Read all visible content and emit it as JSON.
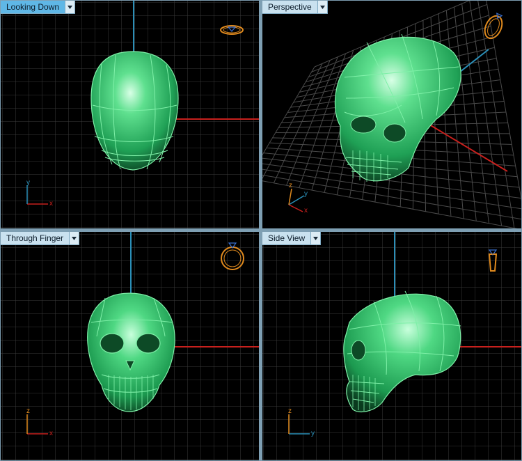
{
  "viewports": [
    {
      "label": "Looking Down",
      "active": true,
      "axes": [
        "y",
        "x"
      ]
    },
    {
      "label": "Perspective",
      "active": false,
      "axes": [
        "z",
        "y",
        "x"
      ]
    },
    {
      "label": "Through Finger",
      "active": false,
      "axes": [
        "z",
        "x"
      ]
    },
    {
      "label": "Side View",
      "active": false,
      "axes": [
        "z",
        "y"
      ]
    }
  ],
  "colors": {
    "grid": "#3a3a3a",
    "grid_major": "#5a5a5a",
    "model": "#2fbf6a",
    "model_wire": "#7ff0a8",
    "axis_x": "#c8201d",
    "axis_y": "#2b8fb8",
    "ring": "#e08a1e",
    "gem": "#3a6fd0",
    "frame": "#7e9fb3"
  },
  "icons": [
    "dropdown-arrow-icon",
    "ring-gizmo-icon",
    "axis-triad-icon"
  ]
}
